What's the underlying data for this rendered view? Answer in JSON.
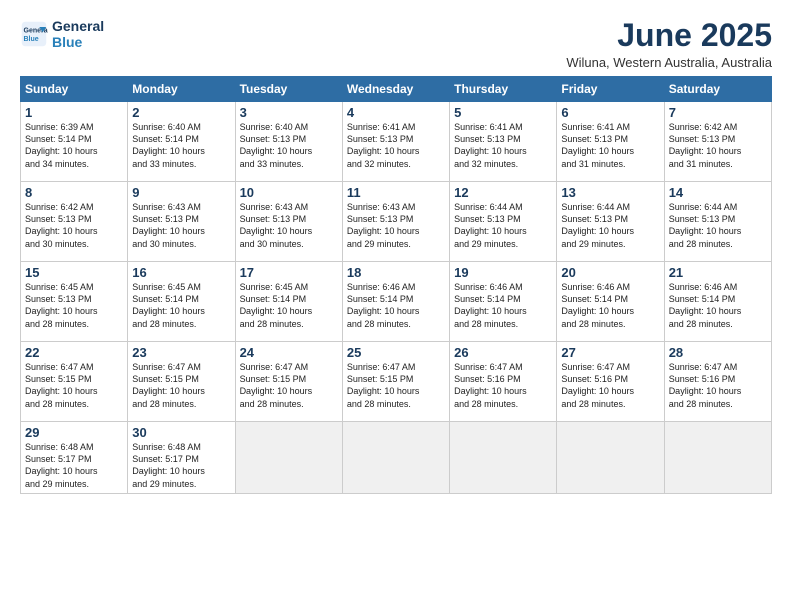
{
  "logo": {
    "line1": "General",
    "line2": "Blue"
  },
  "title": "June 2025",
  "subtitle": "Wiluna, Western Australia, Australia",
  "weekdays": [
    "Sunday",
    "Monday",
    "Tuesday",
    "Wednesday",
    "Thursday",
    "Friday",
    "Saturday"
  ],
  "weeks": [
    [
      {
        "day": "1",
        "info": "Sunrise: 6:39 AM\nSunset: 5:14 PM\nDaylight: 10 hours\nand 34 minutes."
      },
      {
        "day": "2",
        "info": "Sunrise: 6:40 AM\nSunset: 5:14 PM\nDaylight: 10 hours\nand 33 minutes."
      },
      {
        "day": "3",
        "info": "Sunrise: 6:40 AM\nSunset: 5:13 PM\nDaylight: 10 hours\nand 33 minutes."
      },
      {
        "day": "4",
        "info": "Sunrise: 6:41 AM\nSunset: 5:13 PM\nDaylight: 10 hours\nand 32 minutes."
      },
      {
        "day": "5",
        "info": "Sunrise: 6:41 AM\nSunset: 5:13 PM\nDaylight: 10 hours\nand 32 minutes."
      },
      {
        "day": "6",
        "info": "Sunrise: 6:41 AM\nSunset: 5:13 PM\nDaylight: 10 hours\nand 31 minutes."
      },
      {
        "day": "7",
        "info": "Sunrise: 6:42 AM\nSunset: 5:13 PM\nDaylight: 10 hours\nand 31 minutes."
      }
    ],
    [
      {
        "day": "8",
        "info": "Sunrise: 6:42 AM\nSunset: 5:13 PM\nDaylight: 10 hours\nand 30 minutes."
      },
      {
        "day": "9",
        "info": "Sunrise: 6:43 AM\nSunset: 5:13 PM\nDaylight: 10 hours\nand 30 minutes."
      },
      {
        "day": "10",
        "info": "Sunrise: 6:43 AM\nSunset: 5:13 PM\nDaylight: 10 hours\nand 30 minutes."
      },
      {
        "day": "11",
        "info": "Sunrise: 6:43 AM\nSunset: 5:13 PM\nDaylight: 10 hours\nand 29 minutes."
      },
      {
        "day": "12",
        "info": "Sunrise: 6:44 AM\nSunset: 5:13 PM\nDaylight: 10 hours\nand 29 minutes."
      },
      {
        "day": "13",
        "info": "Sunrise: 6:44 AM\nSunset: 5:13 PM\nDaylight: 10 hours\nand 29 minutes."
      },
      {
        "day": "14",
        "info": "Sunrise: 6:44 AM\nSunset: 5:13 PM\nDaylight: 10 hours\nand 28 minutes."
      }
    ],
    [
      {
        "day": "15",
        "info": "Sunrise: 6:45 AM\nSunset: 5:13 PM\nDaylight: 10 hours\nand 28 minutes."
      },
      {
        "day": "16",
        "info": "Sunrise: 6:45 AM\nSunset: 5:14 PM\nDaylight: 10 hours\nand 28 minutes."
      },
      {
        "day": "17",
        "info": "Sunrise: 6:45 AM\nSunset: 5:14 PM\nDaylight: 10 hours\nand 28 minutes."
      },
      {
        "day": "18",
        "info": "Sunrise: 6:46 AM\nSunset: 5:14 PM\nDaylight: 10 hours\nand 28 minutes."
      },
      {
        "day": "19",
        "info": "Sunrise: 6:46 AM\nSunset: 5:14 PM\nDaylight: 10 hours\nand 28 minutes."
      },
      {
        "day": "20",
        "info": "Sunrise: 6:46 AM\nSunset: 5:14 PM\nDaylight: 10 hours\nand 28 minutes."
      },
      {
        "day": "21",
        "info": "Sunrise: 6:46 AM\nSunset: 5:14 PM\nDaylight: 10 hours\nand 28 minutes."
      }
    ],
    [
      {
        "day": "22",
        "info": "Sunrise: 6:47 AM\nSunset: 5:15 PM\nDaylight: 10 hours\nand 28 minutes."
      },
      {
        "day": "23",
        "info": "Sunrise: 6:47 AM\nSunset: 5:15 PM\nDaylight: 10 hours\nand 28 minutes."
      },
      {
        "day": "24",
        "info": "Sunrise: 6:47 AM\nSunset: 5:15 PM\nDaylight: 10 hours\nand 28 minutes."
      },
      {
        "day": "25",
        "info": "Sunrise: 6:47 AM\nSunset: 5:15 PM\nDaylight: 10 hours\nand 28 minutes."
      },
      {
        "day": "26",
        "info": "Sunrise: 6:47 AM\nSunset: 5:16 PM\nDaylight: 10 hours\nand 28 minutes."
      },
      {
        "day": "27",
        "info": "Sunrise: 6:47 AM\nSunset: 5:16 PM\nDaylight: 10 hours\nand 28 minutes."
      },
      {
        "day": "28",
        "info": "Sunrise: 6:47 AM\nSunset: 5:16 PM\nDaylight: 10 hours\nand 28 minutes."
      }
    ],
    [
      {
        "day": "29",
        "info": "Sunrise: 6:48 AM\nSunset: 5:17 PM\nDaylight: 10 hours\nand 29 minutes."
      },
      {
        "day": "30",
        "info": "Sunrise: 6:48 AM\nSunset: 5:17 PM\nDaylight: 10 hours\nand 29 minutes."
      },
      {
        "day": "",
        "info": ""
      },
      {
        "day": "",
        "info": ""
      },
      {
        "day": "",
        "info": ""
      },
      {
        "day": "",
        "info": ""
      },
      {
        "day": "",
        "info": ""
      }
    ]
  ]
}
